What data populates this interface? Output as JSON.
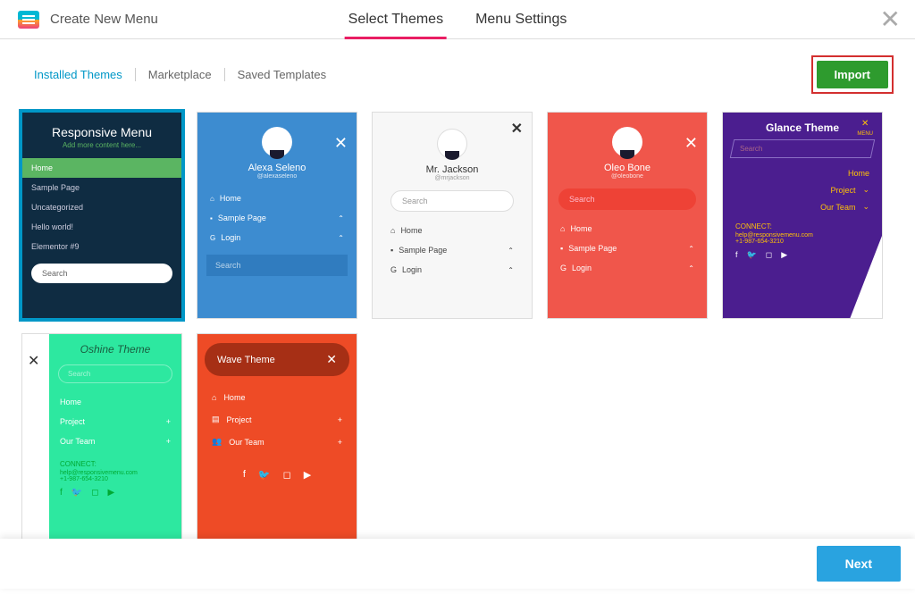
{
  "header": {
    "title": "Create New Menu",
    "tabs": [
      "Select Themes",
      "Menu Settings"
    ]
  },
  "subnav": {
    "items": [
      "Installed Themes",
      "Marketplace",
      "Saved Templates"
    ],
    "importLabel": "Import"
  },
  "footer": {
    "nextLabel": "Next"
  },
  "cards": {
    "responsive": {
      "title": "Responsive Menu",
      "subtitle": "Add more content here...",
      "items": [
        "Home",
        "Sample Page",
        "Uncategorized",
        "Hello world!",
        "Elementor #9"
      ],
      "search": "Search"
    },
    "alexa": {
      "name": "Alexa Seleno",
      "user": "@alexaseleno",
      "items": [
        "Home",
        "Sample Page",
        "Login"
      ],
      "search": "Search"
    },
    "jackson": {
      "name": "Mr. Jackson",
      "user": "@mrjackson",
      "items": [
        "Home",
        "Sample Page",
        "Login"
      ],
      "search": "Search"
    },
    "oleo": {
      "name": "Oleo Bone",
      "user": "@oleobone",
      "items": [
        "Home",
        "Sample Page",
        "Login"
      ],
      "search": "Search"
    },
    "glance": {
      "title": "Glance Theme",
      "search": "Search",
      "menu": "MENU",
      "items": [
        "Home",
        "Project",
        "Our Team"
      ],
      "connect": "CONNECT:",
      "email": "help@responsivemenu.com",
      "phone": "+1-987-654-3210"
    },
    "oshine": {
      "title": "Oshine Theme",
      "search": "Search",
      "items": [
        "Home",
        "Project",
        "Our Team"
      ],
      "connect": "CONNECT:",
      "email": "help@responsivemenu.com",
      "phone": "+1-987-654-3210"
    },
    "wave": {
      "title": "Wave Theme",
      "items": [
        "Home",
        "Project",
        "Our Team"
      ]
    }
  }
}
